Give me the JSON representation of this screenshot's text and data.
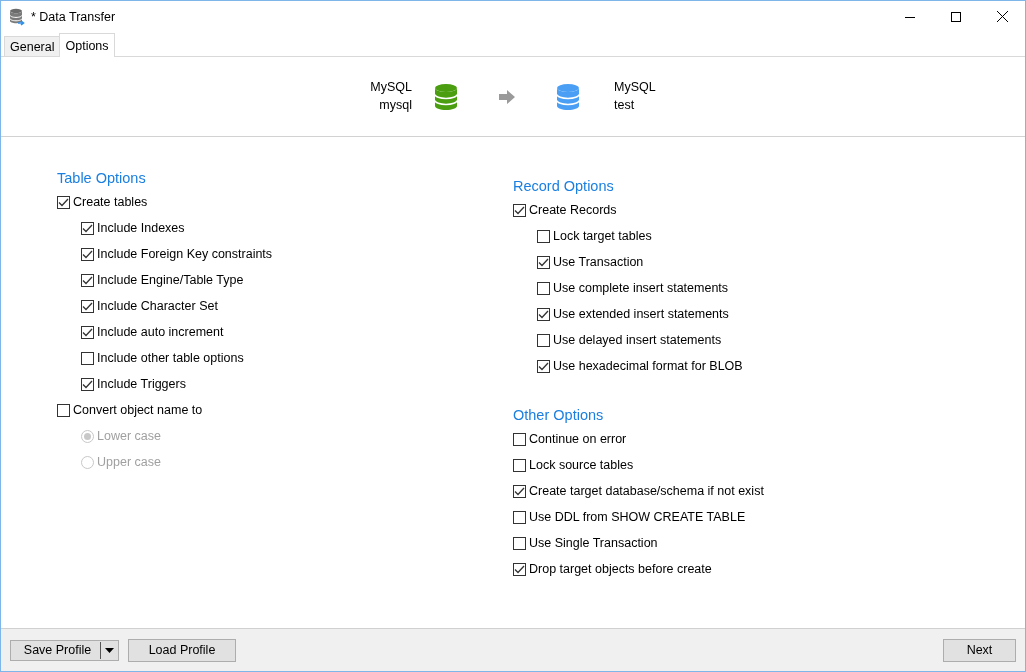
{
  "window": {
    "title": "* Data Transfer"
  },
  "tabs": [
    {
      "label": "General",
      "selected": false
    },
    {
      "label": "Options",
      "selected": true
    }
  ],
  "transfer": {
    "source": {
      "type": "MySQL",
      "name": "mysql"
    },
    "target": {
      "type": "MySQL",
      "name": "test"
    }
  },
  "table_options": {
    "title": "Table Options",
    "items": [
      {
        "kind": "checkbox",
        "label": "Create tables",
        "checked": true,
        "children": [
          {
            "kind": "checkbox",
            "label": "Include Indexes",
            "checked": true
          },
          {
            "kind": "checkbox",
            "label": "Include Foreign Key constraints",
            "checked": true
          },
          {
            "kind": "checkbox",
            "label": "Include Engine/Table Type",
            "checked": true
          },
          {
            "kind": "checkbox",
            "label": "Include Character Set",
            "checked": true
          },
          {
            "kind": "checkbox",
            "label": "Include auto increment",
            "checked": true
          },
          {
            "kind": "checkbox",
            "label": "Include other table options",
            "checked": false
          },
          {
            "kind": "checkbox",
            "label": "Include Triggers",
            "checked": true
          }
        ]
      },
      {
        "kind": "checkbox",
        "label": "Convert object name to",
        "checked": false,
        "children": [
          {
            "kind": "radio",
            "label": "Lower case",
            "selected": true,
            "disabled": true
          },
          {
            "kind": "radio",
            "label": "Upper case",
            "selected": false,
            "disabled": true
          }
        ]
      }
    ]
  },
  "record_options": {
    "title": "Record Options",
    "items": [
      {
        "kind": "checkbox",
        "label": "Create Records",
        "checked": true,
        "children": [
          {
            "kind": "checkbox",
            "label": "Lock target tables",
            "checked": false
          },
          {
            "kind": "checkbox",
            "label": "Use Transaction",
            "checked": true
          },
          {
            "kind": "checkbox",
            "label": "Use complete insert statements",
            "checked": false
          },
          {
            "kind": "checkbox",
            "label": "Use extended insert statements",
            "checked": true
          },
          {
            "kind": "checkbox",
            "label": "Use delayed insert statements",
            "checked": false
          },
          {
            "kind": "checkbox",
            "label": "Use hexadecimal format for BLOB",
            "checked": true
          }
        ]
      }
    ]
  },
  "other_options": {
    "title": "Other Options",
    "items": [
      {
        "kind": "checkbox",
        "label": "Continue on error",
        "checked": false
      },
      {
        "kind": "checkbox",
        "label": "Lock source tables",
        "checked": false
      },
      {
        "kind": "checkbox",
        "label": "Create target database/schema if not exist",
        "checked": true
      },
      {
        "kind": "checkbox",
        "label": "Use DDL from SHOW CREATE TABLE",
        "checked": false
      },
      {
        "kind": "checkbox",
        "label": "Use Single Transaction",
        "checked": false
      },
      {
        "kind": "checkbox",
        "label": "Drop target objects before create",
        "checked": true
      }
    ]
  },
  "footer": {
    "save_button": "Save Profile",
    "load_button": "Load Profile",
    "next_button": "Next"
  }
}
